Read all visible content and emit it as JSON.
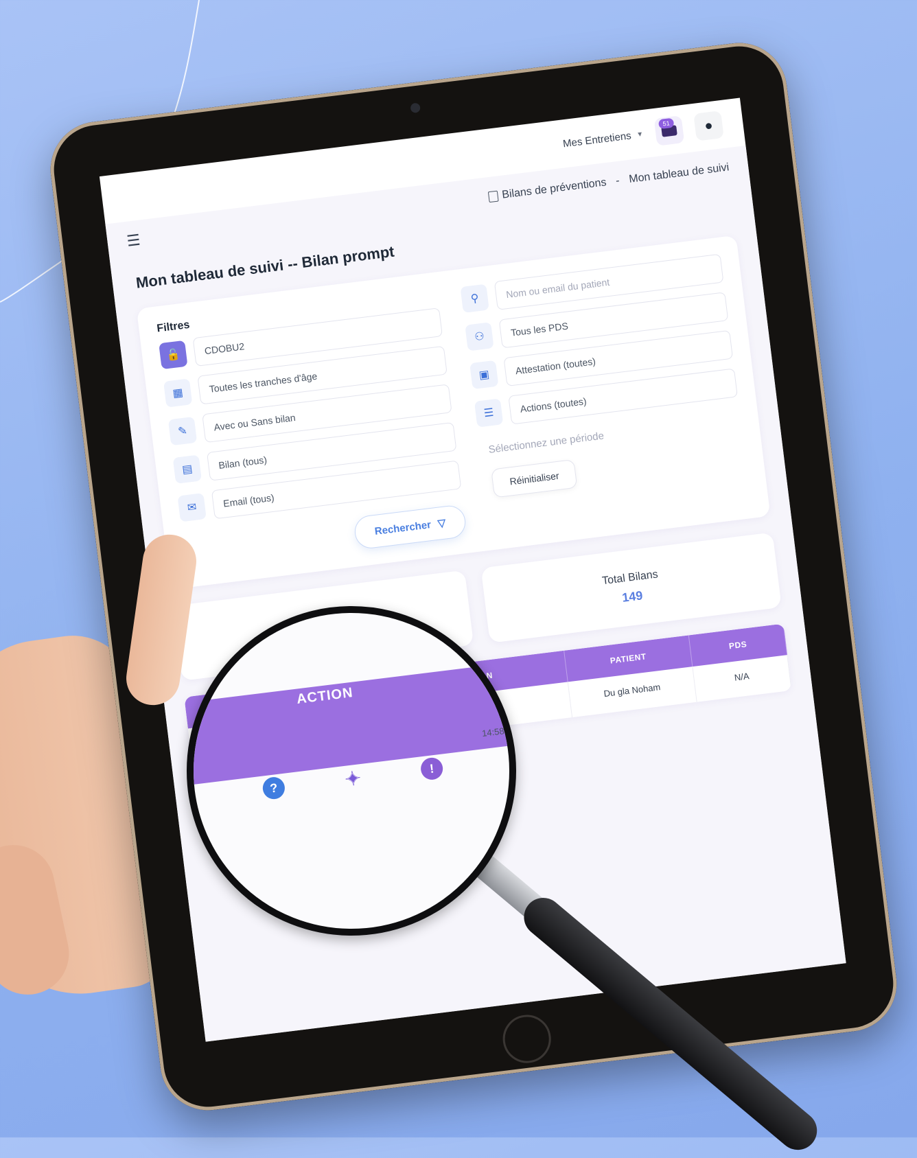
{
  "topbar": {
    "entretiens_label": "Mes Entretiens",
    "monitor_badge": "51"
  },
  "breadcrumb": {
    "items": [
      "Bilans de préventions",
      "Mon tableau de suivi"
    ],
    "separator": "-"
  },
  "page_title": "Mon tableau de suivi -- Bilan prompt",
  "filters": {
    "label": "Filtres",
    "left": [
      {
        "icon": "unlock-icon",
        "value": "CDOBU2"
      },
      {
        "icon": "calendar-icon",
        "value": "Toutes les tranches d'âge"
      },
      {
        "icon": "document-edit-icon",
        "value": "Avec ou Sans bilan"
      },
      {
        "icon": "document-status-icon",
        "value": "Bilan (tous)"
      },
      {
        "icon": "mail-icon",
        "value": "Email (tous)"
      }
    ],
    "right": [
      {
        "icon": "user-search-icon",
        "placeholder": "Nom ou email du patient"
      },
      {
        "icon": "users-icon",
        "value": "Tous les PDS"
      },
      {
        "icon": "certificate-icon",
        "value": "Attestation (toutes)"
      },
      {
        "icon": "checklist-icon",
        "value": "Actions (toutes)"
      }
    ],
    "period_placeholder": "Sélectionnez une période",
    "reset_label": "Réinitialiser",
    "search_label": "Rechercher"
  },
  "stats": {
    "total_label": "Total Bilans",
    "total_value": "149"
  },
  "table": {
    "headers": [
      "ACTION",
      "MISSION",
      "PATIENT",
      "PDS"
    ],
    "rows": [
      {
        "mission_time": "14:58:35",
        "patient": "Du gla Noham",
        "pds": "N/A"
      }
    ]
  },
  "colors": {
    "accent_purple": "#9b6fe0",
    "accent_blue": "#4a7fe0",
    "background": "#8fb1ef"
  }
}
